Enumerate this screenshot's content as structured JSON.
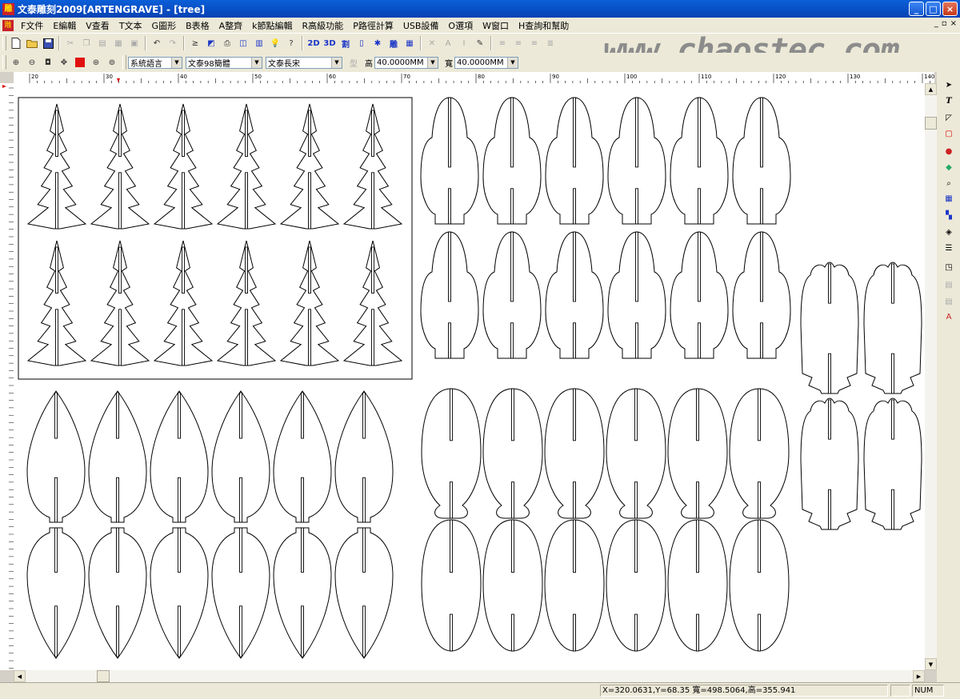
{
  "window": {
    "title": "文泰雕刻2009[ARTENGRAVE] - [tree]",
    "app_icon": "雕",
    "minimize": "_",
    "maximize": "□",
    "close": "×"
  },
  "menu": {
    "logo": "雕",
    "items": [
      "F文件",
      "E編輯",
      "V查看",
      "T文本",
      "G圖形",
      "B表格",
      "A整齊",
      "k節點編輯",
      "R高級功能",
      "P路徑計算",
      "USB設備",
      "O選項",
      "W窗口",
      "H查詢和幫助"
    ],
    "mdi_minimize": "_",
    "mdi_restore": "▫",
    "mdi_close": "×"
  },
  "toolbar2": {
    "language": "系統語言",
    "font": "文泰98簡體",
    "style": "文泰長宋",
    "height_label": "高",
    "height_value": "40.0000MM",
    "width_label": "寬",
    "width_value": "40.0000MM"
  },
  "toolbar1": {
    "btn_2d": "2D",
    "btn_3d": "3D",
    "btn_cut": "割",
    "btn_carve": "雕"
  },
  "watermark": "www.chaostec.com",
  "hruler": {
    "labels": [
      "20",
      "30",
      "40",
      "50",
      "60",
      "70",
      "80",
      "90",
      "100",
      "110",
      "120",
      "130",
      "140"
    ]
  },
  "status": {
    "coords": "X=320.0631,Y=68.35 寬=498.5064,高=355.941",
    "num": "NUM"
  },
  "colors": {
    "titlebar": "#0a5fd8",
    "chrome": "#ece9d8",
    "canvas": "#ffffff",
    "stroke": "#000000"
  },
  "shapes": {
    "tree_group_rows": 2,
    "tree_group_cols": 6,
    "round_group_rows": 2,
    "round_group_cols": 6,
    "leaf_group_rows": 2,
    "leaf_group_cols": 6,
    "egg_group_rows": 2,
    "egg_group_cols": 6,
    "bush_group_rows": 2,
    "bush_group_cols": 2
  }
}
